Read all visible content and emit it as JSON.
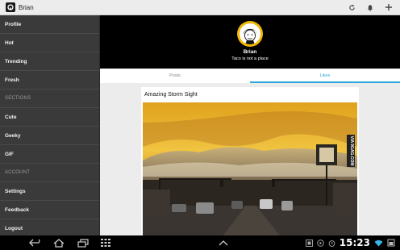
{
  "app": {
    "title": "Brian"
  },
  "actionbar": {
    "icons": [
      "refresh-icon",
      "bell-icon",
      "add-icon"
    ]
  },
  "drawer": {
    "items": [
      {
        "type": "item",
        "label": "Profile"
      },
      {
        "type": "item",
        "label": "Hot"
      },
      {
        "type": "item",
        "label": "Trending"
      },
      {
        "type": "item",
        "label": "Fresh"
      },
      {
        "type": "section",
        "label": "SECTIONS"
      },
      {
        "type": "item",
        "label": "Cute"
      },
      {
        "type": "item",
        "label": "Geeky"
      },
      {
        "type": "item",
        "label": "GIF"
      },
      {
        "type": "section",
        "label": "ACCOUNT"
      },
      {
        "type": "item",
        "label": "Settings"
      },
      {
        "type": "item",
        "label": "Feedback"
      },
      {
        "type": "item",
        "label": "Logout"
      }
    ]
  },
  "profile": {
    "name": "Brian",
    "tagline": "Taco is not a place"
  },
  "tabs": [
    {
      "label": "Posts",
      "active": false
    },
    {
      "label": "Likes",
      "active": true
    }
  ],
  "post": {
    "title": "Amazing Storm Sight",
    "watermark": "VIA 9GAG.COM"
  },
  "statusbar": {
    "time": "15:23",
    "icons": [
      "back-icon",
      "home-icon",
      "recent-apps-icon",
      "grid-icon",
      "up-chevron-icon",
      "screenshot-icon",
      "media-icon",
      "alarm-icon",
      "wifi-icon",
      "signal-icon"
    ]
  },
  "colors": {
    "accent": "#2aa8dc",
    "avatar_ring": "#f2b705",
    "drawer_bg": "#3a3a3a"
  }
}
